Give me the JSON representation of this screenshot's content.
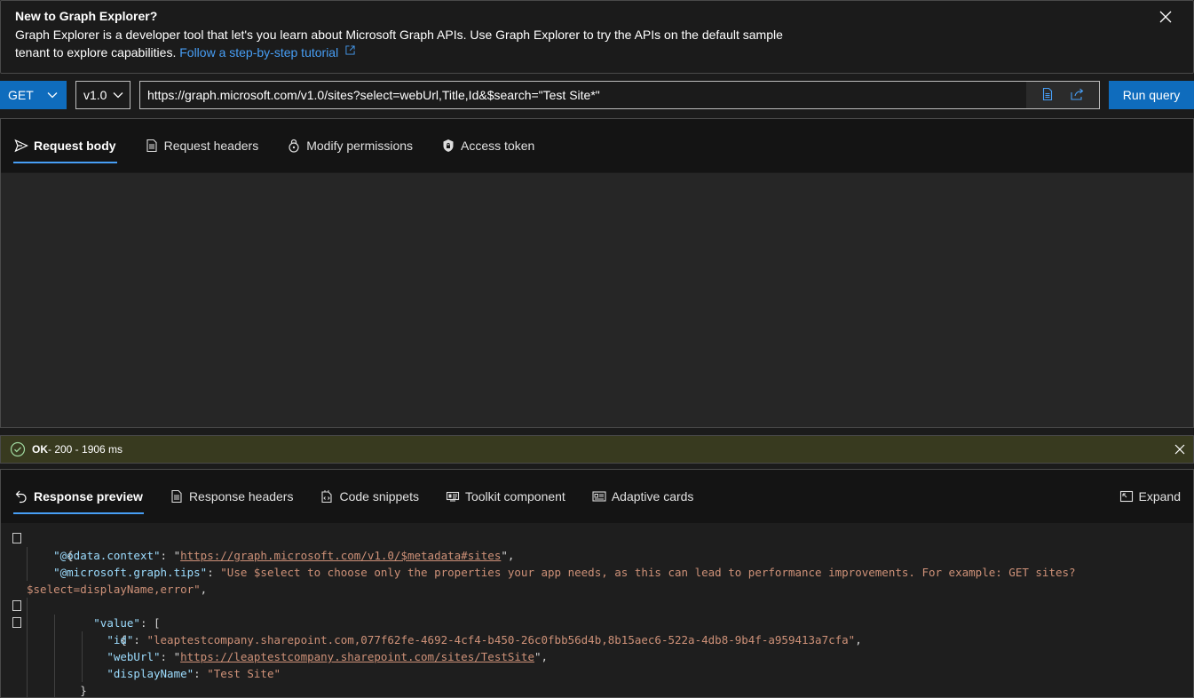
{
  "banner": {
    "title": "New to Graph Explorer?",
    "text": "Graph Explorer is a developer tool that let's you learn about Microsoft Graph APIs. Use Graph Explorer to try the APIs on the default sample tenant to explore capabilities.",
    "link": "Follow a step-by-step tutorial"
  },
  "query": {
    "method": "GET",
    "version": "v1.0",
    "url": "https://graph.microsoft.com/v1.0/sites?select=webUrl,Title,Id&$search=\"Test Site*\"",
    "run_label": "Run query"
  },
  "request_tabs": [
    {
      "label": "Request body",
      "icon": "send-icon"
    },
    {
      "label": "Request headers",
      "icon": "document-icon"
    },
    {
      "label": "Modify permissions",
      "icon": "lock-icon"
    },
    {
      "label": "Access token",
      "icon": "shield-lock-icon"
    }
  ],
  "status": {
    "ok": "OK",
    "detail": " - 200 - 1906 ms",
    "color": "#383a1f"
  },
  "response_tabs": [
    {
      "label": "Response preview",
      "icon": "undo-arrow-icon"
    },
    {
      "label": "Response headers",
      "icon": "document-icon"
    },
    {
      "label": "Code snippets",
      "icon": "code-snippet-icon"
    },
    {
      "label": "Toolkit component",
      "icon": "toolkit-icon"
    },
    {
      "label": "Adaptive cards",
      "icon": "card-icon"
    }
  ],
  "expand_label": "Expand",
  "json": {
    "odata_context_key": "\"@odata.context\"",
    "odata_context_val": "https://graph.microsoft.com/v1.0/$metadata#sites",
    "tips_key": "\"@microsoft.graph.tips\"",
    "tips_val_1": "\"Use $select to choose only the properties your app needs, as this can lead to performance improvements. For example: GET sites?",
    "tips_val_2": "$select=displayName,error\"",
    "value_key": "\"value\"",
    "id_key": "\"id\"",
    "id_val": "\"leaptestcompany.sharepoint.com,077f62fe-4692-4cf4-b450-26c0fbb56d4b,8b15aec6-522a-4db8-9b4f-a959413a7cfa\"",
    "weburl_key": "\"webUrl\"",
    "weburl_val": "https://leaptestcompany.sharepoint.com/sites/TestSite",
    "displayname_key": "\"displayName\"",
    "displayname_val": "\"Test Site\""
  }
}
